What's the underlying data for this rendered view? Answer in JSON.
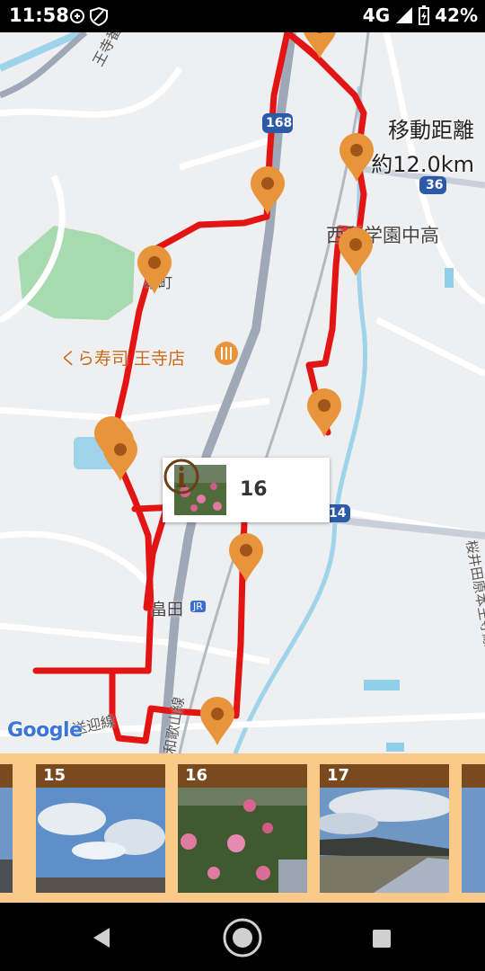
{
  "status": {
    "time": "11:58",
    "network": "4G",
    "battery": "42%"
  },
  "map": {
    "labels": {
      "road_ojijiba": "王寺番芝線",
      "route_168": "168",
      "route_36": "36",
      "route_14": "14",
      "school": "西和学園中高",
      "honmachi": "本町",
      "restaurant": "くら寿司 王寺店",
      "hatada": "畠田",
      "jr": "JR",
      "wakayama_line": "和歌山線",
      "shuttle": "送迎線",
      "sakurai_line": "桜井田原本王寺線"
    },
    "distance_title": "移動距離",
    "distance_value": "約12.0km",
    "route_color": "#e31414",
    "marker_color": "#e8943a",
    "google_logo": "Google"
  },
  "popup": {
    "number": "16",
    "info_icon": "info-circle-icon"
  },
  "photos": [
    {
      "number": "15"
    },
    {
      "number": "16"
    },
    {
      "number": "17"
    }
  ],
  "nav": {
    "back_icon": "back-triangle-icon",
    "home_icon": "home-circle-icon",
    "recents_icon": "recents-square-icon"
  }
}
